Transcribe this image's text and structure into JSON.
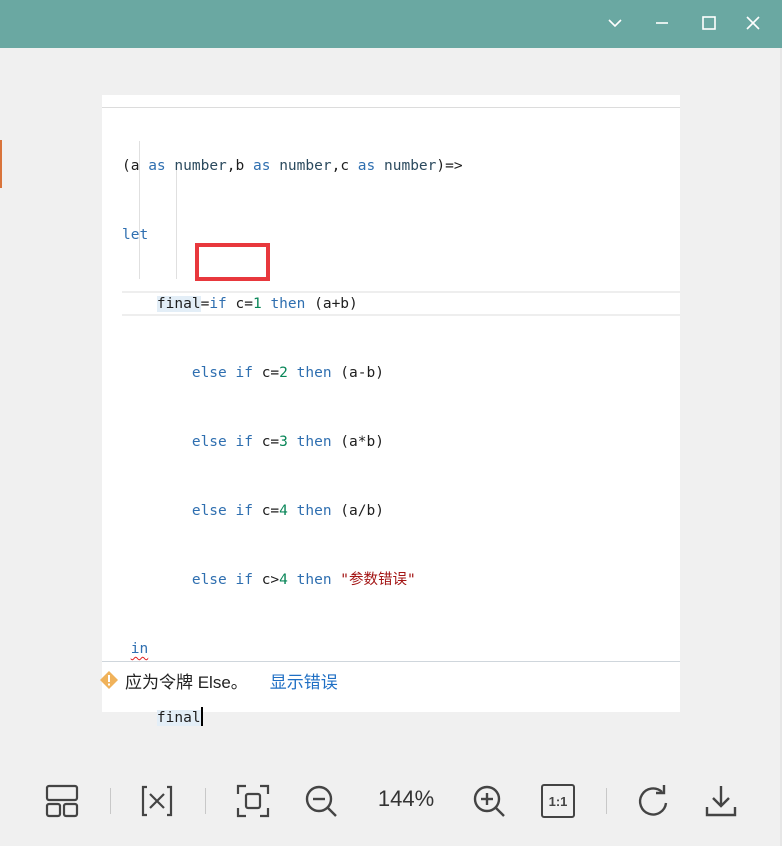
{
  "window": {
    "controls": [
      "chevron-down-icon",
      "minimize-icon",
      "maximize-icon",
      "close-icon"
    ],
    "titlebar_color": "#6aa8a2"
  },
  "code": {
    "l1": {
      "p1": "(a ",
      "as1": "as",
      "p2": " ",
      "n1": "number",
      "p3": ",b ",
      "as2": "as",
      "p4": " ",
      "n2": "number",
      "p5": ",c ",
      "as3": "as",
      "p6": " ",
      "n3": "number",
      "p7": ")=>"
    },
    "l2": {
      "let": "let"
    },
    "l3": {
      "indent": "    ",
      "final": "final",
      "eq": "=",
      "if": "if",
      "cond": " c=",
      "num": "1",
      "sp": " ",
      "then": "then",
      "expr": " (a+b)"
    },
    "l4": {
      "indent": "        ",
      "else": "else",
      "sp1": " ",
      "if": "if",
      "cond": " c=",
      "num": "2",
      "sp": " ",
      "then": "then",
      "expr": " (a-b)"
    },
    "l5": {
      "indent": "        ",
      "else": "else",
      "sp1": " ",
      "if": "if",
      "cond": " c=",
      "num": "3",
      "sp": " ",
      "then": "then",
      "expr": " (a*b)"
    },
    "l6": {
      "indent": "        ",
      "else": "else",
      "sp1": " ",
      "if": "if",
      "cond": " c=",
      "num": "4",
      "sp": " ",
      "then": "then",
      "expr": " (a/b)"
    },
    "l7": {
      "indent": "        ",
      "else": "else",
      "sp1": " ",
      "if": "if",
      "cond": " c>",
      "num": "4",
      "sp": " ",
      "then": "then",
      "sp2": " ",
      "str": "\"参数错误\""
    },
    "l8": {
      "indent": " ",
      "in": "in"
    },
    "l9": {
      "indent": "    ",
      "final": "final"
    }
  },
  "status": {
    "message": "应为令牌 Else。",
    "link": "显示错误",
    "icon": "warning-diamond-icon"
  },
  "toolbar": {
    "items": [
      "layout-icon",
      "formula-icon",
      "fit-screen-icon",
      "zoom-out-icon",
      "zoom-in-icon",
      "actual-size-icon",
      "rotate-icon",
      "download-icon"
    ],
    "zoom_level": "144%",
    "actual_size_label": "1:1"
  },
  "colors": {
    "keyword": "#2f6fb0",
    "number": "#098658",
    "string": "#a31515",
    "highlight_box": "#e8383d",
    "link": "#1f6fc4"
  }
}
